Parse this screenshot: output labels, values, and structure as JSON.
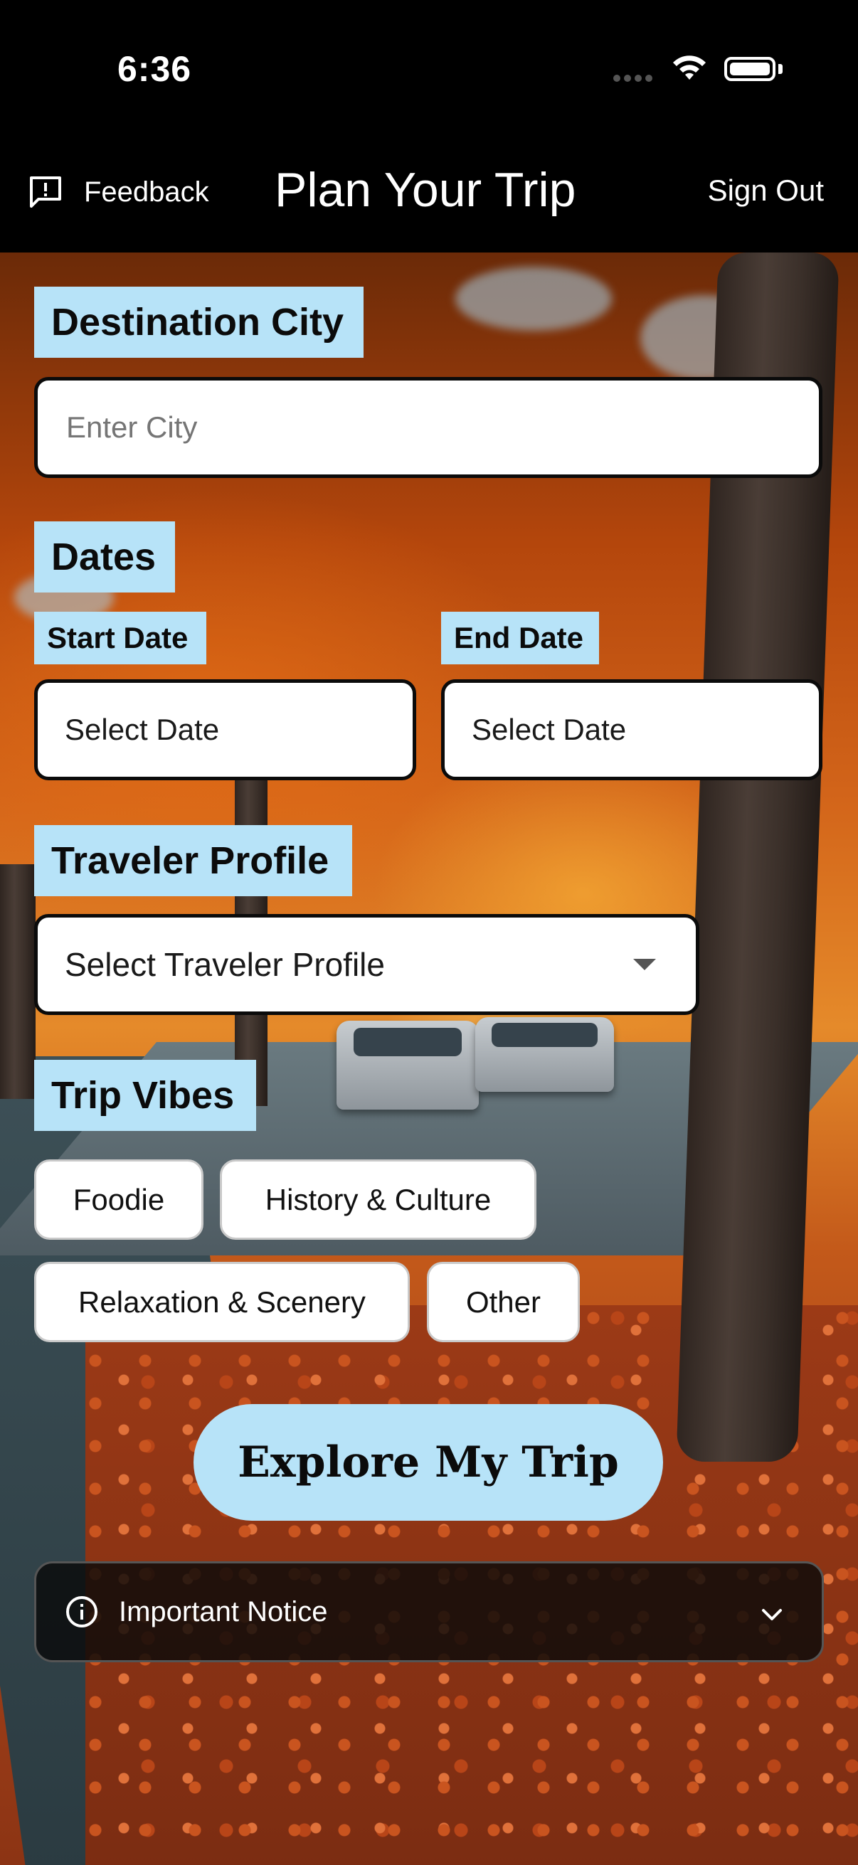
{
  "status_bar": {
    "time": "6:36"
  },
  "header": {
    "feedback_label": "Feedback",
    "title": "Plan Your Trip",
    "sign_out_label": "Sign Out"
  },
  "destination": {
    "section_label": "Destination City",
    "placeholder": "Enter City"
  },
  "dates": {
    "section_label": "Dates",
    "start_label": "Start Date",
    "start_value": "Select Date",
    "end_label": "End Date",
    "end_value": "Select Date"
  },
  "traveler_profile": {
    "section_label": "Traveler Profile",
    "selected": "Select Traveler Profile"
  },
  "trip_vibes": {
    "section_label": "Trip Vibes",
    "options": [
      "Foodie",
      "History & Culture",
      "Relaxation & Scenery",
      "Other"
    ]
  },
  "cta_label": "Explore My Trip",
  "notice": {
    "label": "Important Notice"
  },
  "colors": {
    "accent": "#b7e3f8",
    "header_bg": "#000000",
    "field_border": "#0b0b0b"
  },
  "icons": {
    "feedback": "feedback-icon",
    "dropdown": "caret-down-icon",
    "info": "info-icon",
    "expand": "chevron-down-icon"
  }
}
